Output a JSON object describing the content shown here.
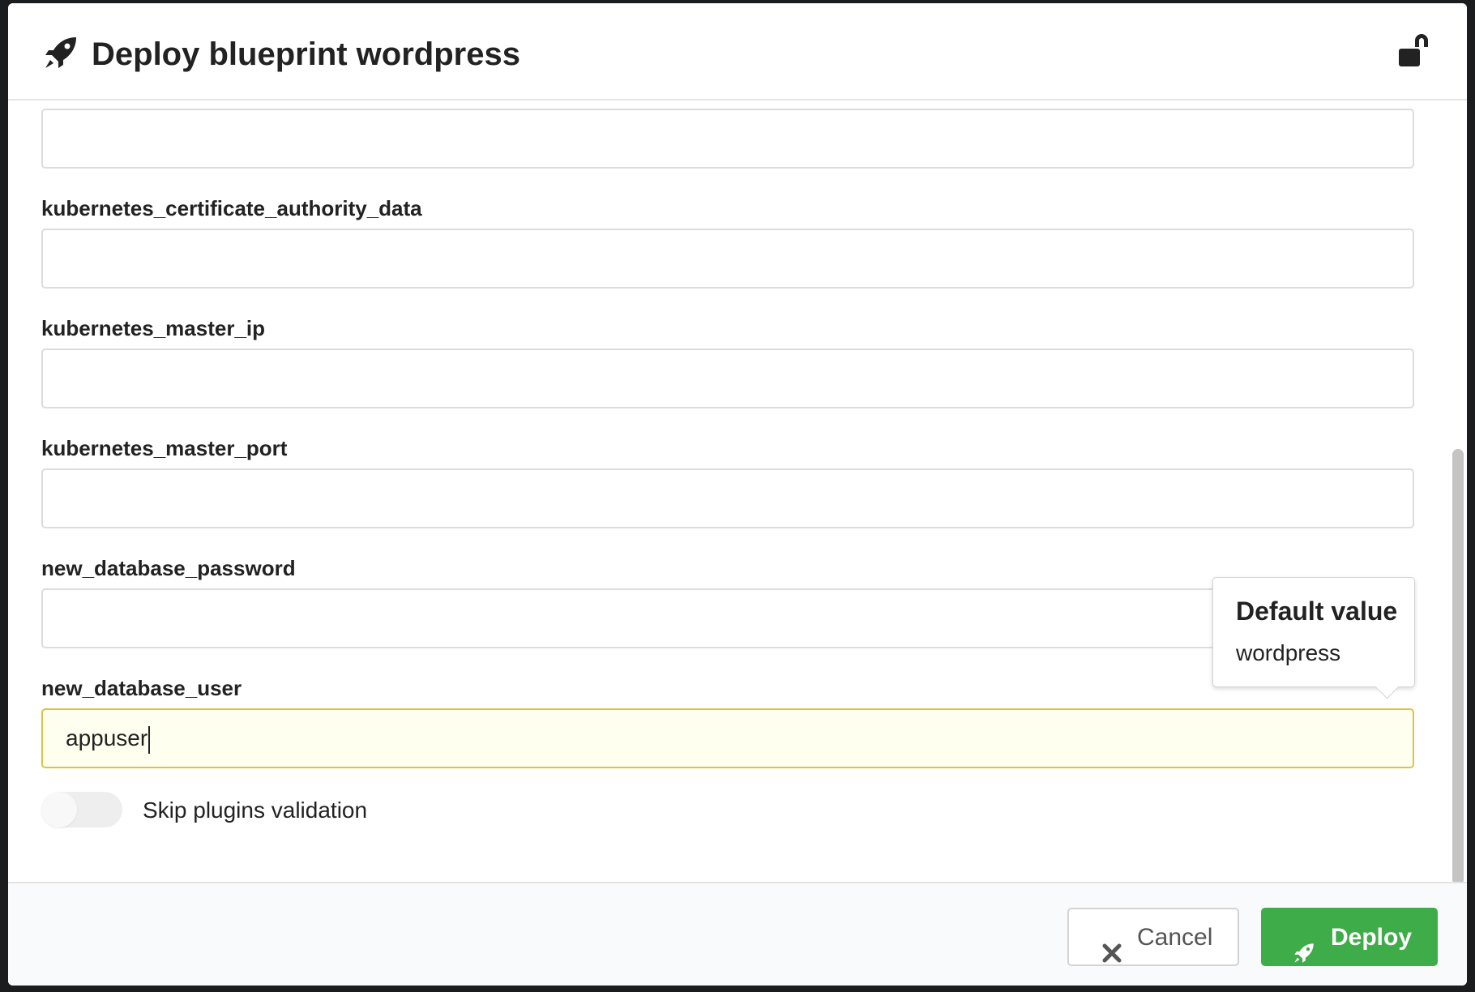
{
  "header": {
    "title": "Deploy blueprint wordpress",
    "title_icon": "rocket-icon",
    "lock_icon": "unlock-icon"
  },
  "fields": [
    {
      "label": "",
      "value": ""
    },
    {
      "label": "kubernetes_certificate_authority_data",
      "value": ""
    },
    {
      "label": "kubernetes_master_ip",
      "value": ""
    },
    {
      "label": "kubernetes_master_port",
      "value": ""
    },
    {
      "label": "new_database_password",
      "value": ""
    },
    {
      "label": "new_database_user",
      "value": "appuser"
    }
  ],
  "tooltip": {
    "title": "Default value",
    "value": "wordpress"
  },
  "toggle": {
    "label": "Skip plugins validation",
    "checked": false
  },
  "footer": {
    "cancel_label": "Cancel",
    "deploy_label": "Deploy",
    "cancel_icon": "close-icon",
    "deploy_icon": "rocket-icon"
  },
  "colors": {
    "deploy_button": "#3eac48",
    "focused_border": "#d9c446",
    "focused_background": "#fffff0"
  }
}
